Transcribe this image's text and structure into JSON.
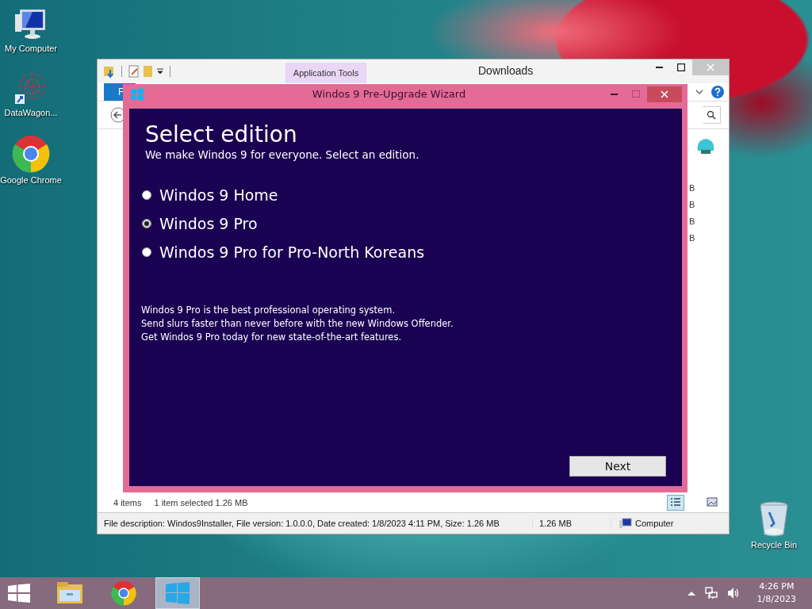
{
  "desktop_icons": [
    {
      "label": "My Computer",
      "kind": "computer"
    },
    {
      "label": "DataWagon...",
      "kind": "network"
    },
    {
      "label": "Google Chrome",
      "kind": "chrome"
    },
    {
      "label": "Recycle Bin",
      "kind": "bin"
    }
  ],
  "explorer": {
    "title": "Downloads",
    "context_tab": "Application Tools",
    "ribbon_tab": "F",
    "size_cells": [
      "B",
      "B",
      "B",
      "B"
    ],
    "status": {
      "count": "4 items",
      "selection": "1 item selected  1.26 MB"
    },
    "details": {
      "description": "File description: Windos9Installer, File version: 1.0.0.0, Date created: 1/8/2023 4:11 PM, Size: 1.26 MB",
      "size": "1.26 MB",
      "location": "Computer"
    }
  },
  "wizard": {
    "title": "Windos 9 Pre-Upgrade Wizard",
    "heading": "Select edition",
    "subheading": "We make Windos 9 for everyone. Select an edition.",
    "editions": [
      {
        "label": "Windos 9 Home",
        "selected": false
      },
      {
        "label": "Windos 9 Pro",
        "selected": true
      },
      {
        "label": "Windos 9 Pro for Pro-North Koreans",
        "selected": false
      }
    ],
    "description": [
      "Windos 9 Pro is the best professional operating system.",
      "Send slurs faster than never before with the new Windows Offender.",
      "Get Windos 9 Pro today for new state-of-the-art features."
    ],
    "next_button": "Next"
  },
  "taskbar": {
    "apps": [
      {
        "kind": "explorer",
        "active": false
      },
      {
        "kind": "chrome",
        "active": false
      },
      {
        "kind": "installer",
        "active": true
      }
    ],
    "time": "4:26 PM",
    "date": "1/8/2023"
  }
}
